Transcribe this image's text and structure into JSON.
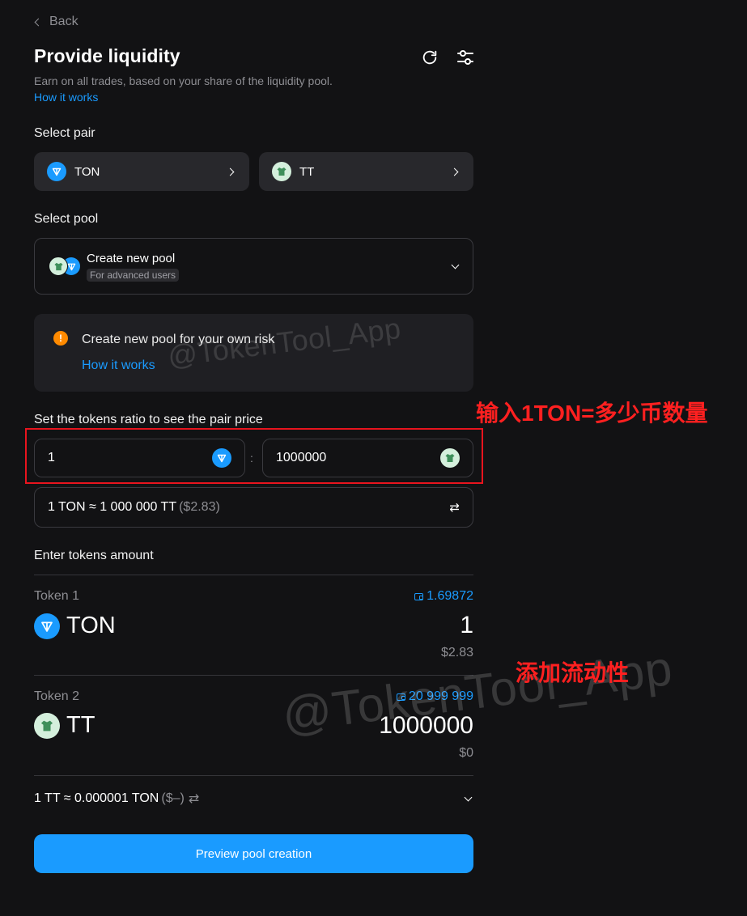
{
  "nav": {
    "back_label": "Back"
  },
  "header": {
    "title": "Provide liquidity",
    "subtitle": "Earn on all trades, based on your share of the liquidity pool.",
    "how_it_works": "How it works"
  },
  "select_pair": {
    "label": "Select pair",
    "token_a": "TON",
    "token_b": "TT"
  },
  "select_pool": {
    "label": "Select pool",
    "name": "Create new pool",
    "badge": "For advanced users"
  },
  "warning": {
    "icon": "!",
    "text": "Create new pool for your own risk",
    "link": "How it works"
  },
  "ratio": {
    "label": "Set the tokens ratio to see the pair price",
    "value_a": "1",
    "separator": ":",
    "value_b": "1000000",
    "price_text": "1 TON ≈ 1 000 000 TT",
    "price_usd": "($2.83)",
    "swap_icon": "⇄"
  },
  "amounts": {
    "label": "Enter tokens amount",
    "token1": {
      "label": "Token 1",
      "balance": "1.69872",
      "symbol": "TON",
      "amount": "1",
      "usd": "$2.83"
    },
    "token2": {
      "label": "Token 2",
      "balance": "20 999 999",
      "symbol": "TT",
      "amount": "1000000",
      "usd": "$0"
    },
    "rate_text": "1 TT ≈ 0.000001 TON",
    "rate_usd": "($–)",
    "rate_swap_icon": "⇄"
  },
  "preview_button": "Preview pool creation",
  "overlays": {
    "watermark": "@TokenTool_App",
    "annotation_ratio": "输入1TON=多少币数量",
    "annotation_liquidity": "添加流动性"
  },
  "colors": {
    "background": "#121214",
    "accent": "#1a9bff",
    "warning": "#ff8a00",
    "annotation": "#ff2020"
  }
}
